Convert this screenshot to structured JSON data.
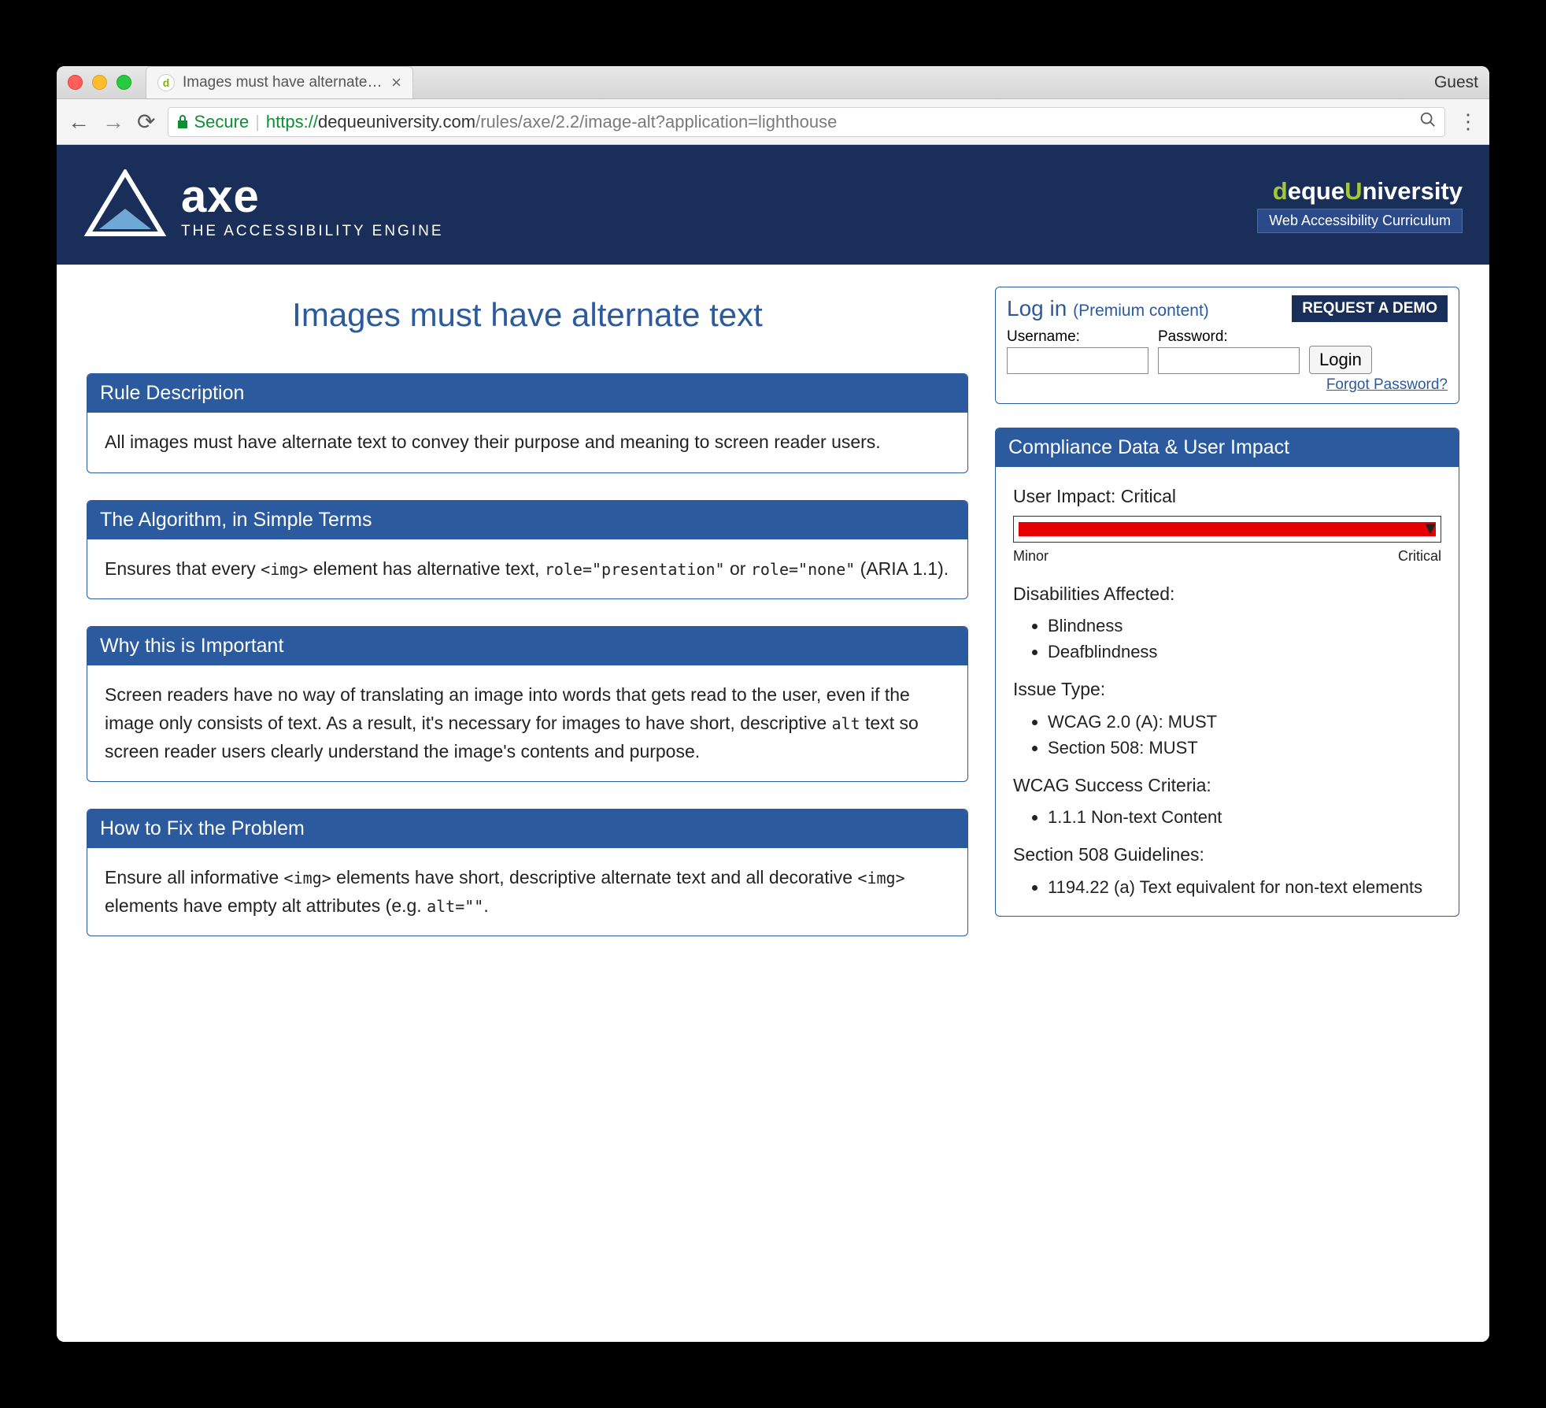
{
  "browser": {
    "tab_title": "Images must have alternate tex",
    "guest": "Guest",
    "secure_label": "Secure",
    "url_proto": "https://",
    "url_host": "dequeuniversity.com",
    "url_path": "/rules/axe/2.2/image-alt?application=lighthouse"
  },
  "banner": {
    "logo_word": "axe",
    "tagline": "THE ACCESSIBILITY ENGINE",
    "uni_pre": "d",
    "uni_eque": "eque",
    "uni_u": "U",
    "uni_niversity": "niversity",
    "uni_sub": "Web Accessibility Curriculum"
  },
  "page_title": "Images must have alternate text",
  "panels": {
    "rule_h": "Rule Description",
    "rule_b": "All images must have alternate text to convey their purpose and meaning to screen reader users.",
    "algo_h": "The Algorithm, in Simple Terms",
    "algo_b_pre": "Ensures that every ",
    "algo_b_code1": "<img>",
    "algo_b_mid": " element has alternative text, ",
    "algo_b_code2": "role=\"presentation\"",
    "algo_b_or": " or ",
    "algo_b_code3": "role=\"none\"",
    "algo_b_suf": " (ARIA 1.1).",
    "why_h": "Why this is Important",
    "why_b_pre": "Screen readers have no way of translating an image into words that gets read to the user, even if the image only consists of text. As a result, it's necessary for images to have short, descriptive ",
    "why_b_code": "alt",
    "why_b_suf": " text so screen reader users clearly understand the image's contents and purpose.",
    "fix_h": "How to Fix the Problem",
    "fix_b_1": "Ensure all informative ",
    "fix_b_c1": "<img>",
    "fix_b_2": " elements have short, descriptive alternate text and all decorative ",
    "fix_b_c2": "<img>",
    "fix_b_3": " elements have empty alt attributes (e.g. ",
    "fix_b_c3": "alt=\"\"",
    "fix_b_4": "."
  },
  "login": {
    "title": "Log in",
    "subtitle": "(Premium content)",
    "demo": "REQUEST A DEMO",
    "username_label": "Username:",
    "password_label": "Password:",
    "login_btn": "Login",
    "forgot": "Forgot Password?"
  },
  "compliance": {
    "header": "Compliance Data & User Impact",
    "impact_label": "User Impact:",
    "impact_value": "Critical",
    "scale_min": "Minor",
    "scale_max": "Critical",
    "dis_h": "Disabilities Affected:",
    "dis_items": [
      "Blindness",
      "Deafblindness"
    ],
    "issue_h": "Issue Type:",
    "issue_items": [
      "WCAG 2.0 (A): MUST",
      "Section 508: MUST"
    ],
    "wcag_h": "WCAG Success Criteria:",
    "wcag_items": [
      "1.1.1 Non-text Content"
    ],
    "s508_h": "Section 508 Guidelines:",
    "s508_items": [
      "1194.22 (a) Text equivalent for non-text elements"
    ]
  }
}
